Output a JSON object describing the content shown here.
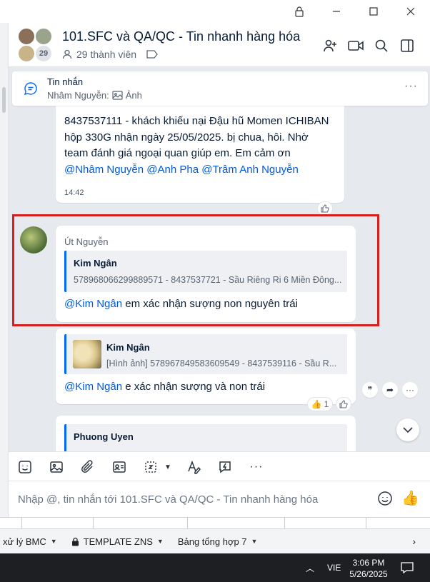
{
  "conversation": {
    "title": "101.SFC và QA/QC - Tin nhanh hàng hóa",
    "member_count_badge": "29",
    "members_label": "29 thành viên"
  },
  "pinned": {
    "title": "Tin nhắn",
    "sender": "Nhâm Nguyễn:",
    "content": "Ảnh"
  },
  "messages": [
    {
      "lines": [
        "8437537111 - khách khiếu nại Đậu hũ Momen ICHIBAN",
        "hộp 330G nhận ngày 25/05/2025.  bị chua, hôi. Nhờ",
        "team đánh giá ngoại quan giúp em. Em cảm ơn"
      ],
      "mentions": "@Nhâm Nguyễn @Anh Pha @Trâm Anh Nguyễn",
      "time": "14:42"
    },
    {
      "sender": "Út Nguyễn",
      "quote_name": "Kim Ngân",
      "quote_text": "578968066299889571 - 8437537721 - Sầu Riêng Ri 6 Miền Đông...",
      "mention": "@Kim Ngân",
      "text": " em xác nhận sượng non nguyên trái"
    },
    {
      "quote_name": "Kim Ngân",
      "quote_text": "[Hình ảnh] 578967849583609549 - 8437539116 - Sầu R...",
      "mention": "@Kim Ngân",
      "text": " e xác nhận sượng và non trái",
      "reaction_count": "1"
    },
    {
      "quote_name": "Phuong Uyen"
    }
  ],
  "composer": {
    "placeholder": "Nhập @, tin nhắn tới 101.SFC và QA/QC - Tin nhanh hàng hóa"
  },
  "sheet_tabs": [
    {
      "label": "xử lý BMC",
      "locked": false
    },
    {
      "label": "TEMPLATE ZNS",
      "locked": true
    },
    {
      "label": "Bảng tổng hợp 7",
      "locked": false
    }
  ],
  "taskbar": {
    "lang": "VIE",
    "time": "3:06 PM",
    "date": "5/26/2025"
  },
  "icons": {
    "accent": "#0068ff",
    "mention_color": "#005ae0",
    "highlight_color": "#d61f1f"
  }
}
